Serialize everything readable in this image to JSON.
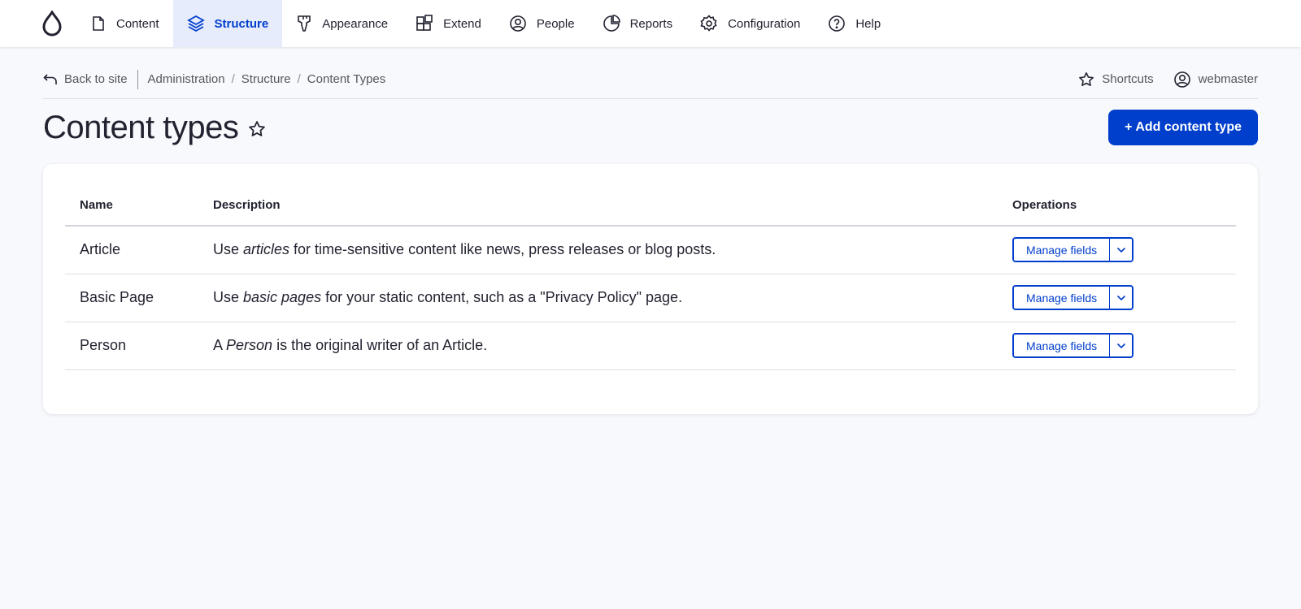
{
  "nav": {
    "items": [
      {
        "label": "Content",
        "icon": "file-icon"
      },
      {
        "label": "Structure",
        "icon": "layers-icon"
      },
      {
        "label": "Appearance",
        "icon": "brush-icon"
      },
      {
        "label": "Extend",
        "icon": "puzzle-blocks-icon"
      },
      {
        "label": "People",
        "icon": "user-icon"
      },
      {
        "label": "Reports",
        "icon": "pie-chart-icon"
      },
      {
        "label": "Configuration",
        "icon": "gear-icon"
      },
      {
        "label": "Help",
        "icon": "help-icon"
      }
    ],
    "active": "Structure"
  },
  "breadcrumb": {
    "back_label": "Back to site",
    "items": [
      "Administration",
      "Structure",
      "Content Types"
    ],
    "separator": "/"
  },
  "tools": {
    "shortcuts_label": "Shortcuts",
    "user_label": "webmaster"
  },
  "page": {
    "title": "Content types",
    "add_button_label": "+ Add content type"
  },
  "table": {
    "headers": {
      "name": "Name",
      "description": "Description",
      "operations": "Operations"
    },
    "rows": [
      {
        "name": "Article",
        "desc_pre": "Use ",
        "desc_em": "articles",
        "desc_post": " for time-sensitive content like news, press releases or blog posts.",
        "operation": "Manage fields"
      },
      {
        "name": "Basic Page",
        "desc_pre": "Use ",
        "desc_em": "basic pages",
        "desc_post": " for your static content, such as a \"Privacy Policy\" page.",
        "operation": "Manage fields"
      },
      {
        "name": "Person",
        "desc_pre": "A ",
        "desc_em": "Person",
        "desc_post": " is the original writer of an Article.",
        "operation": "Manage fields"
      }
    ]
  },
  "colors": {
    "accent": "#003ecc",
    "active_nav_bg": "#e6ecfc",
    "page_bg": "#f7f9fd"
  }
}
